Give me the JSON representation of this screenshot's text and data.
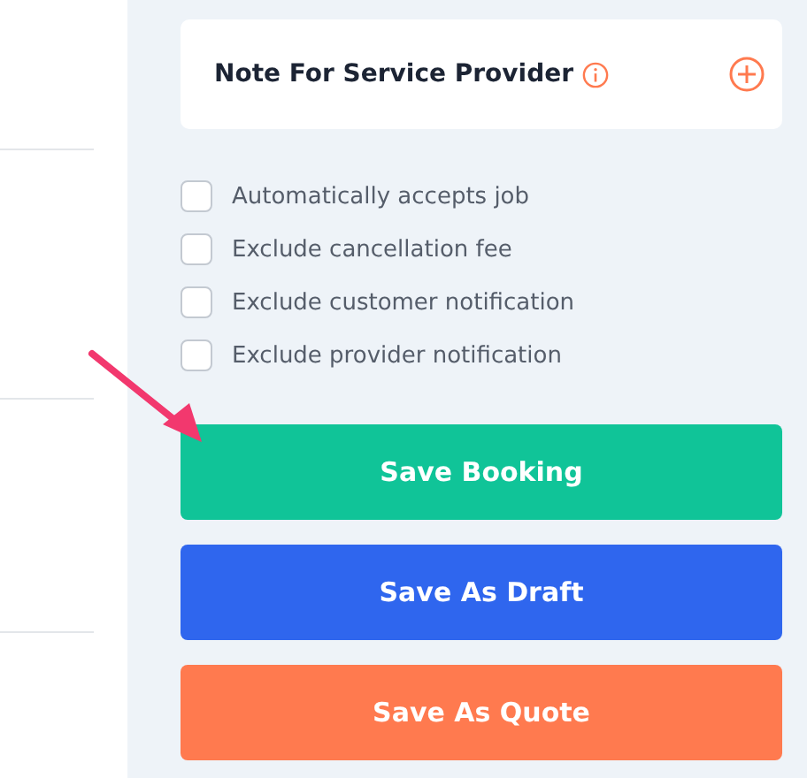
{
  "note_card": {
    "title": "Note For Service Provider"
  },
  "options": [
    {
      "label": "Automatically accepts job",
      "checked": false
    },
    {
      "label": "Exclude cancellation fee",
      "checked": false
    },
    {
      "label": "Exclude customer notification",
      "checked": false
    },
    {
      "label": "Exclude provider notification",
      "checked": false
    }
  ],
  "buttons": [
    {
      "label": "Save Booking",
      "kind": "success"
    },
    {
      "label": "Save As Draft",
      "kind": "primary"
    },
    {
      "label": "Save As Quote",
      "kind": "warning"
    }
  ]
}
